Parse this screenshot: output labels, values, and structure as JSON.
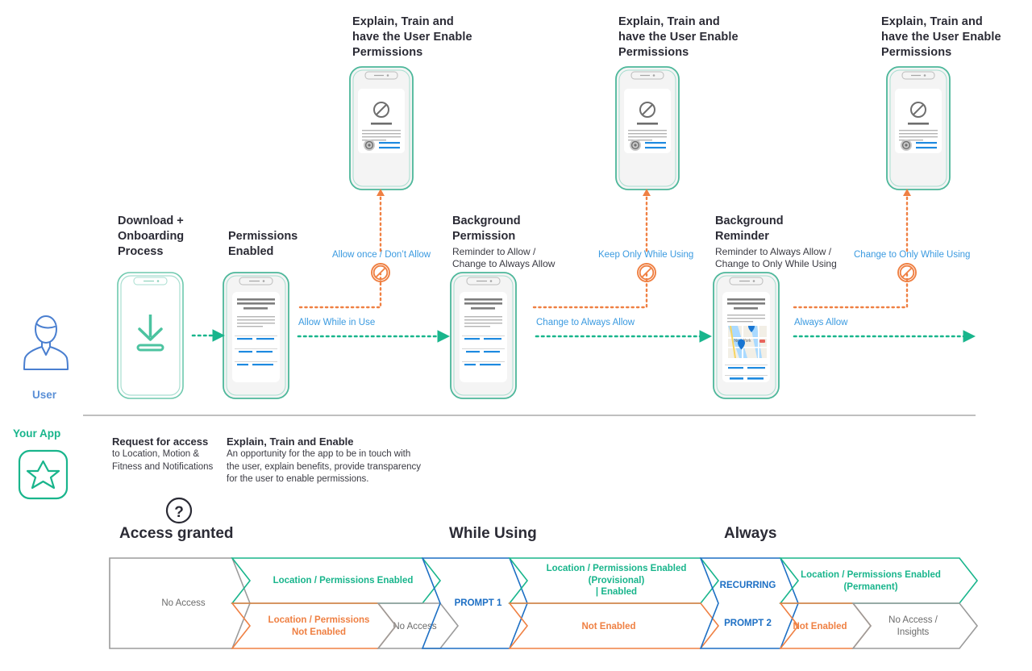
{
  "lanes": {
    "user": {
      "label": "User",
      "icon": "user-avatar-icon"
    },
    "app": {
      "label": "Your App",
      "icon": "app-star-logo-icon"
    }
  },
  "top_callouts": [
    {
      "id": "callout-1",
      "line1": "Explain, Train and",
      "line2": "have the User Enable",
      "line3": "Permissions"
    },
    {
      "id": "callout-2",
      "line1": "Explain, Train and",
      "line2": "have the User Enable",
      "line3": "Permissions"
    },
    {
      "id": "callout-3",
      "line1": "Explain, Train and",
      "line2": "have the User Enable",
      "line3": "Permissions"
    }
  ],
  "stages": [
    {
      "id": "stage-download",
      "title_lines": [
        "Download +",
        "Onboarding",
        "Process"
      ],
      "sub_lines": [],
      "phone": "download-arrow-phone"
    },
    {
      "id": "stage-permissions-enabled",
      "title_lines": [
        "Permissions",
        "Enabled"
      ],
      "sub_lines": [],
      "phone": "content-card-phone"
    },
    {
      "id": "stage-background-permission",
      "title_lines": [
        "Background",
        "Permission"
      ],
      "sub_lines": [
        "Reminder to Allow /",
        "Change to Always Allow"
      ],
      "phone": "content-card-phone"
    },
    {
      "id": "stage-background-reminder",
      "title_lines": [
        "Background",
        "Reminder"
      ],
      "sub_lines": [
        "Reminder to Always Allow /",
        "Change to Only While Using"
      ],
      "phone": "map-card-phone"
    }
  ],
  "edges": {
    "reject": [
      {
        "id": "edge-reject-1",
        "label": "Allow once / Don’t Allow"
      },
      {
        "id": "edge-reject-2",
        "label": "Keep Only While Using"
      },
      {
        "id": "edge-reject-3",
        "label": "Change to Only While Using"
      }
    ],
    "accept": [
      {
        "id": "edge-accept-1",
        "label": "Allow While in Use"
      },
      {
        "id": "edge-accept-2",
        "label": "Change to Always Allow"
      },
      {
        "id": "edge-accept-3",
        "label": "Always Allow"
      }
    ]
  },
  "legend": [
    {
      "id": "legend-request-access",
      "title": "Request for access",
      "body_lines": [
        "to Location, Motion &",
        "Fitness and Notifications"
      ]
    },
    {
      "id": "legend-explain-train-enable",
      "title": "Explain, Train and Enable",
      "body_lines": [
        "An opportunity for the app to be in touch with",
        "the user, explain benefits, provide transparency",
        "for the user to enable permissions."
      ]
    }
  ],
  "phases": [
    {
      "id": "phase-access-granted",
      "label": "Access granted",
      "icon": "question-mark-circle-icon"
    },
    {
      "id": "phase-while-using",
      "label": "While Using"
    },
    {
      "id": "phase-always",
      "label": "Always"
    }
  ],
  "funnel": {
    "top_row": [
      {
        "id": "chev-no-access-start",
        "lines": [
          "No Access"
        ],
        "color_key": "gray",
        "bold": false
      },
      {
        "id": "chev-location-enabled-1",
        "lines": [
          "Location / Permissions Enabled"
        ],
        "color_key": "green",
        "bold": true
      },
      {
        "id": "chev-prompt-1",
        "lines": [
          "PROMPT 1"
        ],
        "color_key": "blue",
        "bold": true
      },
      {
        "id": "chev-location-enabled-provisional",
        "lines": [
          "Location / Permissions Enabled",
          "(Provisional)",
          "| Enabled"
        ],
        "color_key": "green",
        "bold": true
      },
      {
        "id": "chev-recurring",
        "lines": [
          "RECURRING"
        ],
        "color_key": "blue",
        "bold": true
      },
      {
        "id": "chev-location-enabled-permanent",
        "lines": [
          "Location / Permissions Enabled",
          "(Permanent)"
        ],
        "color_key": "green",
        "bold": true
      }
    ],
    "bottom_row": [
      {
        "id": "chev-location-not-enabled",
        "lines": [
          "Location / Permissions",
          "Not Enabled"
        ],
        "color_key": "orange",
        "bold": true
      },
      {
        "id": "chev-no-access-2",
        "lines": [
          "No Access"
        ],
        "color_key": "gray",
        "bold": false
      },
      {
        "id": "chev-not-enabled-1",
        "lines": [
          "Not Enabled"
        ],
        "color_key": "orange",
        "bold": true
      },
      {
        "id": "chev-prompt-2",
        "lines": [
          "PROMPT 2"
        ],
        "color_key": "blue",
        "bold": true
      },
      {
        "id": "chev-not-enabled-2",
        "lines": [
          "Not Enabled"
        ],
        "color_key": "orange",
        "bold": true
      },
      {
        "id": "chev-no-access-insights",
        "lines": [
          "No Access /",
          "Insights"
        ],
        "color_key": "gray",
        "bold": false
      }
    ]
  },
  "colors": {
    "green": "#19b58c",
    "orange": "#ef8043",
    "blue": "#1d6fc4",
    "link_blue": "#3a9ae0",
    "gray": "#9b9b9b",
    "text_dark": "#2b2b35",
    "user_blue": "#5a8fd6"
  }
}
